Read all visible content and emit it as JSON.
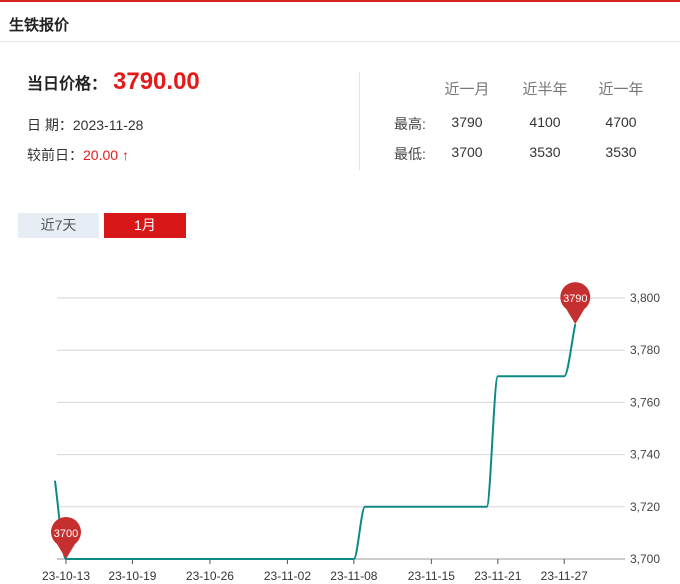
{
  "header": {
    "title": "生铁报价"
  },
  "price": {
    "label": "当日价格：",
    "value": "3790.00"
  },
  "date": {
    "label": "日 期：",
    "value": "2023-11-28"
  },
  "change": {
    "label": "较前日：",
    "value": "20.00",
    "arrow": "↑"
  },
  "stats": {
    "columns": [
      "近一月",
      "近半年",
      "近一年"
    ],
    "rows": [
      {
        "label": "最高:",
        "values": [
          "3790",
          "4100",
          "4700"
        ]
      },
      {
        "label": "最低:",
        "values": [
          "3700",
          "3530",
          "3530"
        ]
      }
    ]
  },
  "tabs": [
    {
      "label": "近7天",
      "active": false
    },
    {
      "label": "1月",
      "active": true
    }
  ],
  "colors": {
    "accent": "#d81818",
    "line": "#0d8a86",
    "marker": "#c62f2f"
  },
  "chart_data": {
    "type": "line",
    "title": "",
    "xlabel": "",
    "ylabel": "",
    "ylim": [
      3700,
      3800
    ],
    "y_ticks": [
      "3,700",
      "3,720",
      "3,740",
      "3,760",
      "3,780",
      "3,800"
    ],
    "x_ticks": [
      "23-10-13",
      "23-10-19",
      "23-10-26",
      "23-11-02",
      "23-11-08",
      "23-11-15",
      "23-11-21",
      "23-11-27"
    ],
    "grid": true,
    "y_axis_position": "right",
    "series": [
      {
        "x": [
          "2023-10-12",
          "2023-10-13",
          "2023-10-16",
          "2023-10-17",
          "2023-10-18",
          "2023-10-19",
          "2023-10-20",
          "2023-10-23",
          "2023-10-24",
          "2023-10-25",
          "2023-10-26",
          "2023-10-27",
          "2023-10-30",
          "2023-10-31",
          "2023-11-01",
          "2023-11-02",
          "2023-11-03",
          "2023-11-06",
          "2023-11-07",
          "2023-11-08",
          "2023-11-09",
          "2023-11-10",
          "2023-11-13",
          "2023-11-14",
          "2023-11-15",
          "2023-11-16",
          "2023-11-17",
          "2023-11-20",
          "2023-11-21",
          "2023-11-22",
          "2023-11-23",
          "2023-11-24",
          "2023-11-27",
          "2023-11-28"
        ],
        "values": [
          3730,
          3700,
          3700,
          3700,
          3700,
          3700,
          3700,
          3700,
          3700,
          3700,
          3700,
          3700,
          3700,
          3700,
          3700,
          3700,
          3700,
          3700,
          3700,
          3700,
          3720,
          3720,
          3720,
          3720,
          3720,
          3720,
          3720,
          3720,
          3770,
          3770,
          3770,
          3770,
          3770,
          3790
        ]
      }
    ],
    "markers": [
      {
        "label": "3700",
        "x": "2023-10-13",
        "value": 3700
      },
      {
        "label": "3790",
        "x": "2023-11-28",
        "value": 3790
      }
    ]
  }
}
